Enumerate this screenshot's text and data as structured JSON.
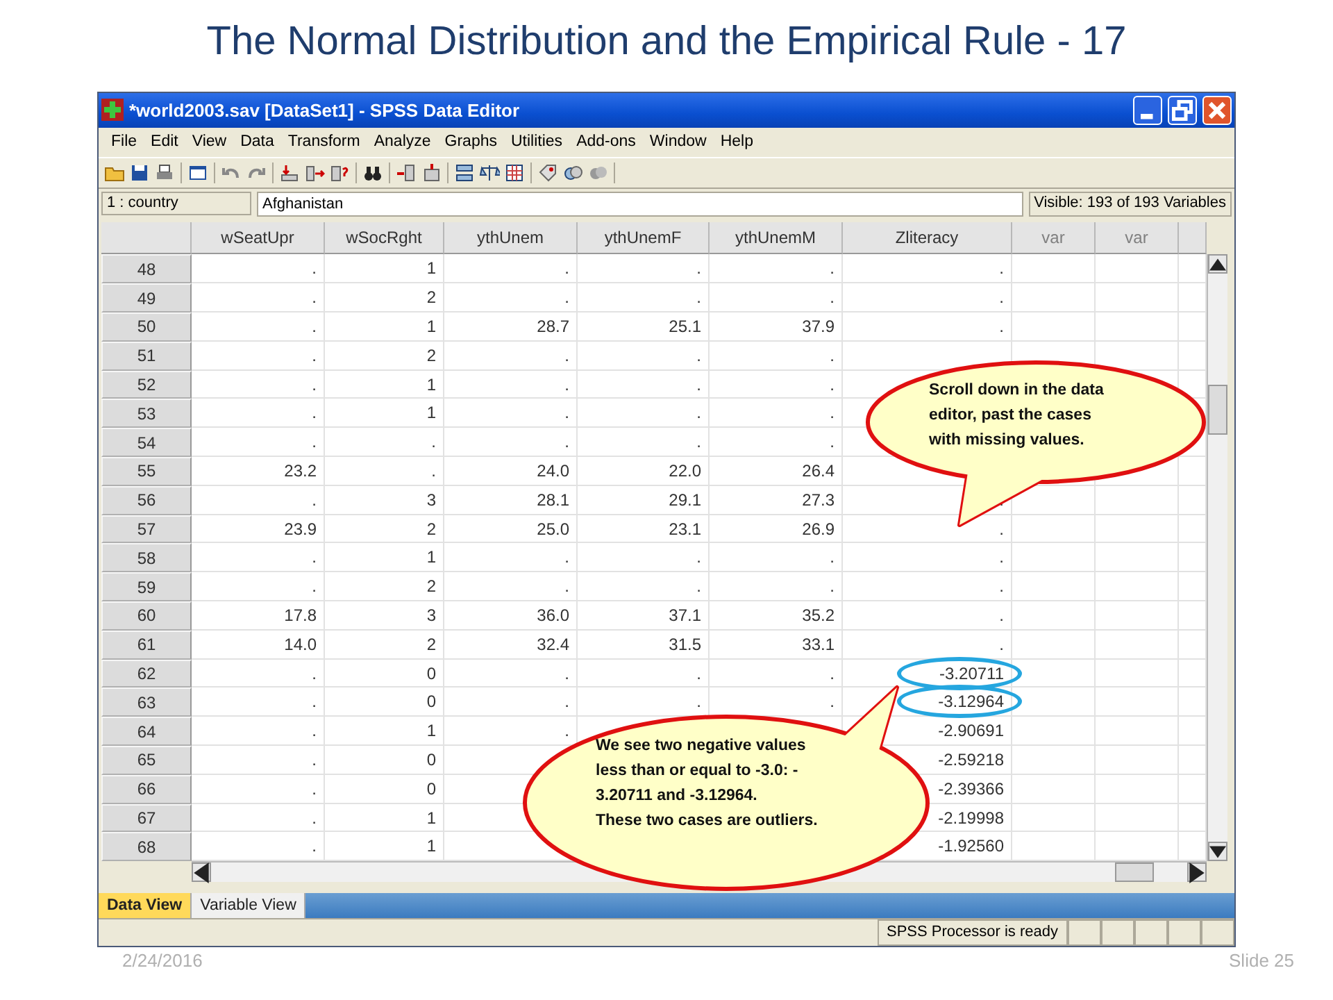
{
  "slide_title": "The Normal Distribution and the Empirical Rule - 17",
  "window": {
    "title": "*world2003.sav [DataSet1] - SPSS Data Editor"
  },
  "menu": [
    "File",
    "Edit",
    "View",
    "Data",
    "Transform",
    "Analyze",
    "Graphs",
    "Utilities",
    "Add-ons",
    "Window",
    "Help"
  ],
  "cell_editor": {
    "cell": "1 : country",
    "value": "Afghanistan",
    "visible": "Visible: 193 of 193 Variables"
  },
  "columns": [
    {
      "label": "wSeatUpr",
      "kind": "var"
    },
    {
      "label": "wSocRght",
      "kind": "var"
    },
    {
      "label": "ythUnem",
      "kind": "var"
    },
    {
      "label": "ythUnemF",
      "kind": "var"
    },
    {
      "label": "ythUnemM",
      "kind": "var"
    },
    {
      "label": "Zliteracy",
      "kind": "var"
    },
    {
      "label": "var",
      "kind": "empty"
    },
    {
      "label": "var",
      "kind": "empty"
    }
  ],
  "rows": [
    {
      "row": "48",
      "cells": [
        ".",
        "1",
        ".",
        ".",
        ".",
        "."
      ],
      "circled": false
    },
    {
      "row": "49",
      "cells": [
        ".",
        "2",
        ".",
        ".",
        ".",
        "."
      ],
      "circled": false
    },
    {
      "row": "50",
      "cells": [
        ".",
        "1",
        "28.7",
        "25.1",
        "37.9",
        "."
      ],
      "circled": false
    },
    {
      "row": "51",
      "cells": [
        ".",
        "2",
        ".",
        ".",
        "."
      ],
      "circled": false
    },
    {
      "row": "52",
      "cells": [
        ".",
        "1",
        ".",
        ".",
        "."
      ],
      "circled": false
    },
    {
      "row": "53",
      "cells": [
        ".",
        "1",
        ".",
        ".",
        "."
      ],
      "circled": false
    },
    {
      "row": "54",
      "cells": [
        ".",
        ".",
        ".",
        ".",
        "."
      ],
      "circled": false
    },
    {
      "row": "55",
      "cells": [
        "23.2",
        ".",
        "24.0",
        "22.0",
        "26.4"
      ],
      "circled": false
    },
    {
      "row": "56",
      "cells": [
        ".",
        "3",
        "28.1",
        "29.1",
        "27.3",
        "."
      ],
      "circled": false
    },
    {
      "row": "57",
      "cells": [
        "23.9",
        "2",
        "25.0",
        "23.1",
        "26.9",
        "."
      ],
      "circled": false
    },
    {
      "row": "58",
      "cells": [
        ".",
        "1",
        ".",
        ".",
        ".",
        "."
      ],
      "circled": false
    },
    {
      "row": "59",
      "cells": [
        ".",
        "2",
        ".",
        ".",
        ".",
        "."
      ],
      "circled": false
    },
    {
      "row": "60",
      "cells": [
        "17.8",
        "3",
        "36.0",
        "37.1",
        "35.2",
        "."
      ],
      "circled": false
    },
    {
      "row": "61",
      "cells": [
        "14.0",
        "2",
        "32.4",
        "31.5",
        "33.1",
        "."
      ],
      "circled": false
    },
    {
      "row": "62",
      "cells": [
        ".",
        "0",
        ".",
        ".",
        ".",
        "-3.20711"
      ],
      "circled": true
    },
    {
      "row": "63",
      "cells": [
        ".",
        "0",
        ".",
        ".",
        ".",
        "-3.12964"
      ],
      "circled": true
    },
    {
      "row": "64",
      "cells": [
        ".",
        "1",
        ".",
        null,
        null,
        "-2.90691"
      ],
      "circled": false
    },
    {
      "row": "65",
      "cells": [
        ".",
        "0",
        null,
        null,
        null,
        "-2.59218"
      ],
      "circled": false
    },
    {
      "row": "66",
      "cells": [
        ".",
        "0",
        null,
        null,
        null,
        "-2.39366"
      ],
      "circled": false
    },
    {
      "row": "67",
      "cells": [
        ".",
        "1",
        null,
        null,
        null,
        "-2.19998"
      ],
      "circled": false
    },
    {
      "row": "68",
      "cells": [
        ".",
        "1",
        null,
        null,
        null,
        "-1.92560"
      ],
      "circled": false
    }
  ],
  "callouts": [
    {
      "paragraphs": [
        "Scroll down in the data editor, past the cases with missing values."
      ]
    },
    {
      "paragraphs": [
        "We see two negative values less than or equal to -3.0: - 3.20711 and -3.12964.",
        "These two cases are outliers."
      ]
    }
  ],
  "tabs": [
    {
      "label": "Data View",
      "selected": true
    },
    {
      "label": "Variable View",
      "selected": false
    }
  ],
  "status_bar": "SPSS  Processor is ready",
  "footer": {
    "date": "2/24/2016",
    "slide": "Slide 25"
  }
}
